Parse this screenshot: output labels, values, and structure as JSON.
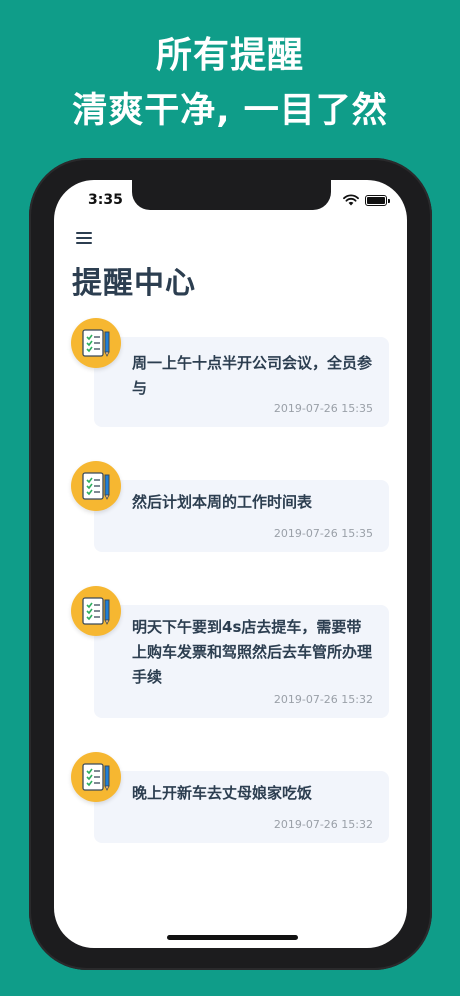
{
  "promo": {
    "line1": "所有提醒",
    "line2": "清爽干净, 一目了然"
  },
  "status_bar": {
    "time": "3:35"
  },
  "icons": {
    "menu": "hamburger-menu-icon",
    "reminder": "checklist-document-icon",
    "wifi": "wifi-icon",
    "battery": "battery-icon"
  },
  "colors": {
    "background": "#0f9d89",
    "badge": "#f6b731",
    "card": "#f2f5fb",
    "title": "#2c3e50"
  },
  "page": {
    "title": "提醒中心"
  },
  "reminders": [
    {
      "text": "周一上午十点半开公司会议，全员参与",
      "time": "2019-07-26 15:35"
    },
    {
      "text": "然后计划本周的工作时间表",
      "time": "2019-07-26 15:35"
    },
    {
      "text": "明天下午要到4s店去提车，需要带上购车发票和驾照然后去车管所办理手续",
      "time": "2019-07-26 15:32"
    },
    {
      "text": "晚上开新车去丈母娘家吃饭",
      "time": "2019-07-26 15:32"
    }
  ]
}
